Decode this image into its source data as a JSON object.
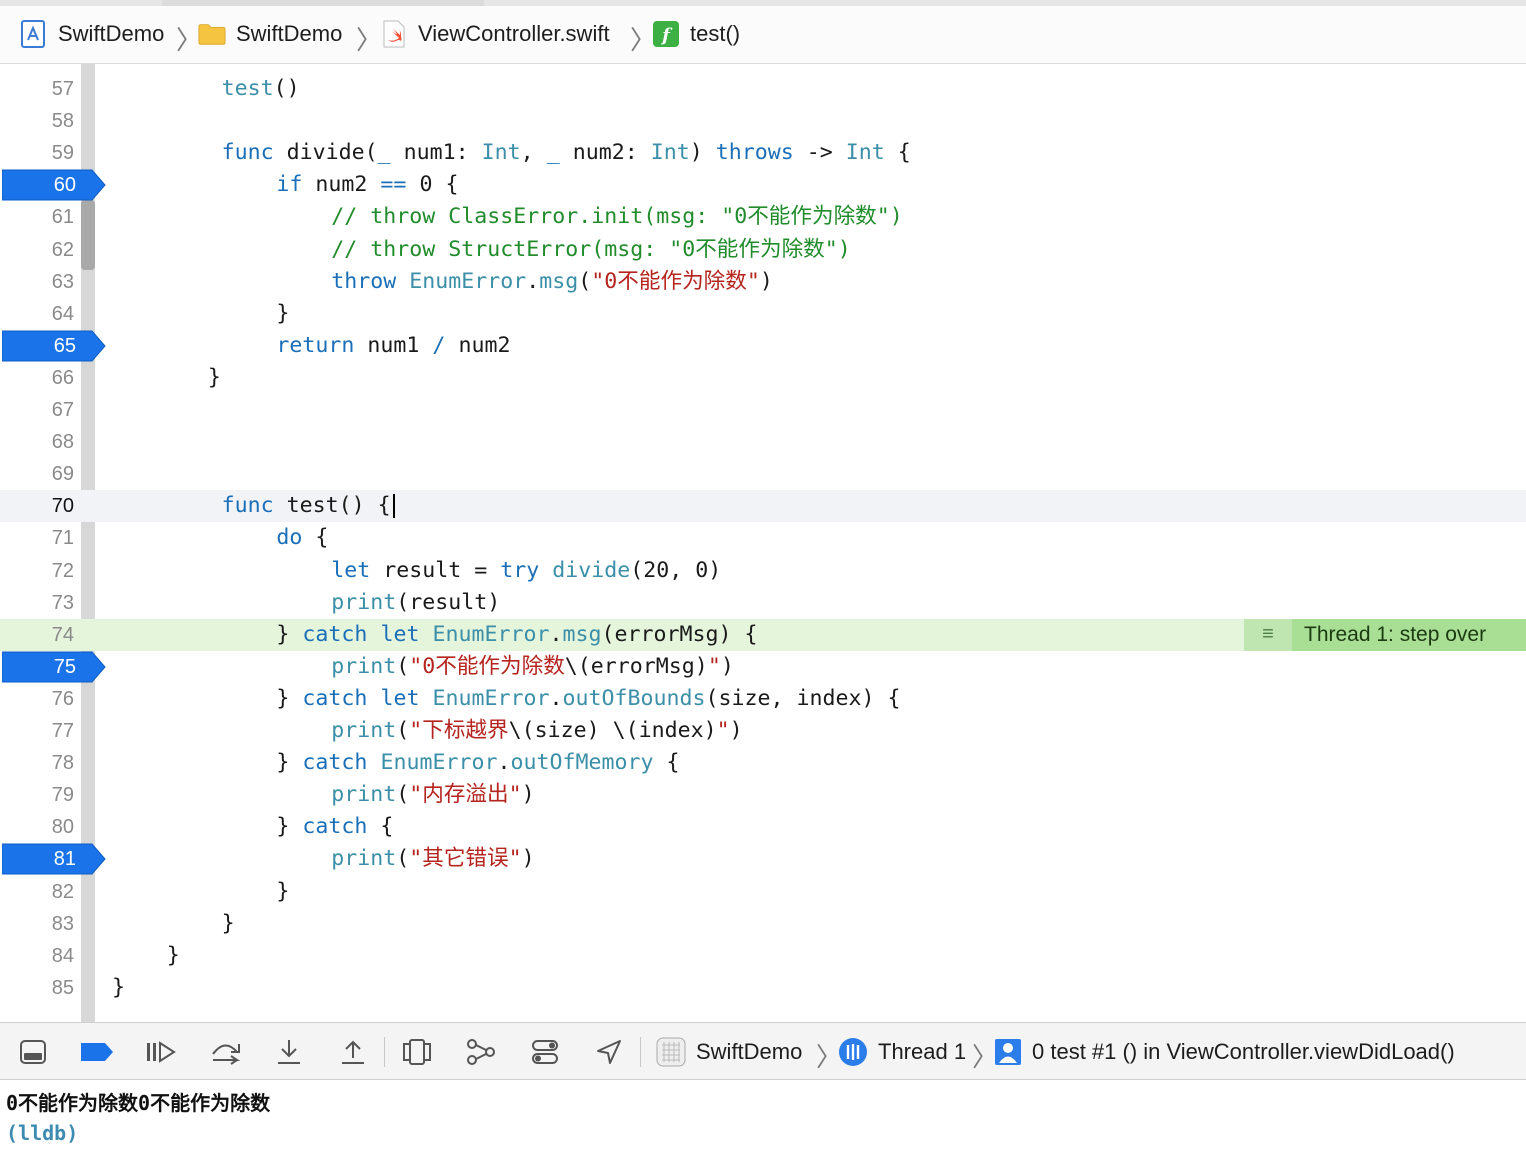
{
  "breadcrumb": {
    "project": "SwiftDemo",
    "group": "SwiftDemo",
    "file": "ViewController.swift",
    "symbol": "test()"
  },
  "editor": {
    "first_line_number": 57,
    "lines": [
      {
        "n": "57",
        "t": [
          [
            "fn",
            "test"
          ],
          [
            "p",
            "()"
          ]
        ],
        "indent": 4
      },
      {
        "n": "58",
        "t": [],
        "indent": 0
      },
      {
        "n": "59",
        "t": [
          [
            "kw",
            "func"
          ],
          [
            "p",
            " divide("
          ],
          [
            "kw",
            "_"
          ],
          [
            "p",
            " num1: "
          ],
          [
            "ty",
            "Int"
          ],
          [
            "p",
            ", "
          ],
          [
            "kw",
            "_"
          ],
          [
            "p",
            " num2: "
          ],
          [
            "ty",
            "Int"
          ],
          [
            "p",
            ") "
          ],
          [
            "kw",
            "throws"
          ],
          [
            "p",
            " -> "
          ],
          [
            "ty",
            "Int"
          ],
          [
            "p",
            " {"
          ]
        ],
        "indent": 4
      },
      {
        "n": "60",
        "t": [
          [
            "kw",
            "if"
          ],
          [
            "p",
            " num2 "
          ],
          [
            "kw",
            "=="
          ],
          [
            "p",
            " 0 {"
          ]
        ],
        "indent": 6
      },
      {
        "n": "61",
        "t": [
          [
            "cm",
            "// throw ClassError.init(msg: \"0不能作为除数\")"
          ]
        ],
        "indent": 8
      },
      {
        "n": "62",
        "t": [
          [
            "cm",
            "// throw StructError(msg: \"0不能作为除数\")"
          ]
        ],
        "indent": 8
      },
      {
        "n": "63",
        "t": [
          [
            "kw",
            "throw"
          ],
          [
            "p",
            " "
          ],
          [
            "ty",
            "EnumError"
          ],
          [
            "p",
            "."
          ],
          [
            "fn",
            "msg"
          ],
          [
            "p",
            "("
          ],
          [
            "st",
            "\"0不能作为除数\""
          ],
          [
            "p",
            ")"
          ]
        ],
        "indent": 8
      },
      {
        "n": "64",
        "t": [
          [
            "p",
            "}"
          ]
        ],
        "indent": 6
      },
      {
        "n": "65",
        "t": [
          [
            "kw",
            "return"
          ],
          [
            "p",
            " num1 "
          ],
          [
            "kw",
            "/"
          ],
          [
            "p",
            " num2"
          ]
        ],
        "indent": 6
      },
      {
        "n": "66",
        "t": [
          [
            "p",
            "}"
          ]
        ],
        "indent": 3.5
      },
      {
        "n": "67",
        "t": [],
        "indent": 0
      },
      {
        "n": "68",
        "t": [],
        "indent": 0
      },
      {
        "n": "69",
        "t": [],
        "indent": 0
      },
      {
        "n": "70",
        "t": [
          [
            "kw",
            "func"
          ],
          [
            "p",
            " test() {"
          ]
        ],
        "indent": 4
      },
      {
        "n": "71",
        "t": [
          [
            "kw",
            "do"
          ],
          [
            "p",
            " {"
          ]
        ],
        "indent": 6
      },
      {
        "n": "72",
        "t": [
          [
            "kw",
            "let"
          ],
          [
            "p",
            " result = "
          ],
          [
            "kw",
            "try"
          ],
          [
            "p",
            " "
          ],
          [
            "fn",
            "divide"
          ],
          [
            "p",
            "(20, 0)"
          ]
        ],
        "indent": 8
      },
      {
        "n": "73",
        "t": [
          [
            "fn",
            "print"
          ],
          [
            "p",
            "(result)"
          ]
        ],
        "indent": 8
      },
      {
        "n": "74",
        "t": [
          [
            "p",
            "} "
          ],
          [
            "kw",
            "catch"
          ],
          [
            "p",
            " "
          ],
          [
            "kw",
            "let"
          ],
          [
            "p",
            " "
          ],
          [
            "ty",
            "EnumError"
          ],
          [
            "p",
            "."
          ],
          [
            "fn",
            "msg"
          ],
          [
            "p",
            "(errorMsg) {"
          ]
        ],
        "indent": 6
      },
      {
        "n": "75",
        "t": [
          [
            "fn",
            "print"
          ],
          [
            "p",
            "("
          ],
          [
            "st",
            "\"0不能作为除数"
          ],
          [
            "p",
            "\\(errorMsg)"
          ],
          [
            "st",
            "\""
          ],
          [
            "p",
            ")"
          ]
        ],
        "indent": 8
      },
      {
        "n": "76",
        "t": [
          [
            "p",
            "} "
          ],
          [
            "kw",
            "catch"
          ],
          [
            "p",
            " "
          ],
          [
            "kw",
            "let"
          ],
          [
            "p",
            " "
          ],
          [
            "ty",
            "EnumError"
          ],
          [
            "p",
            "."
          ],
          [
            "fn",
            "outOfBounds"
          ],
          [
            "p",
            "(size, index) {"
          ]
        ],
        "indent": 6
      },
      {
        "n": "77",
        "t": [
          [
            "fn",
            "print"
          ],
          [
            "p",
            "("
          ],
          [
            "st",
            "\"下标越界"
          ],
          [
            "p",
            "\\(size) \\(index)"
          ],
          [
            "st",
            "\""
          ],
          [
            "p",
            ")"
          ]
        ],
        "indent": 8
      },
      {
        "n": "78",
        "t": [
          [
            "p",
            "} "
          ],
          [
            "kw",
            "catch"
          ],
          [
            "p",
            " "
          ],
          [
            "ty",
            "EnumError"
          ],
          [
            "p",
            "."
          ],
          [
            "fn",
            "outOfMemory"
          ],
          [
            "p",
            " {"
          ]
        ],
        "indent": 6
      },
      {
        "n": "79",
        "t": [
          [
            "fn",
            "print"
          ],
          [
            "p",
            "("
          ],
          [
            "st",
            "\"内存溢出\""
          ],
          [
            "p",
            ")"
          ]
        ],
        "indent": 8
      },
      {
        "n": "80",
        "t": [
          [
            "p",
            "} "
          ],
          [
            "kw",
            "catch"
          ],
          [
            "p",
            " {"
          ]
        ],
        "indent": 6
      },
      {
        "n": "81",
        "t": [
          [
            "fn",
            "print"
          ],
          [
            "p",
            "("
          ],
          [
            "st",
            "\"其它错误\""
          ],
          [
            "p",
            ")"
          ]
        ],
        "indent": 8
      },
      {
        "n": "82",
        "t": [
          [
            "p",
            "}"
          ]
        ],
        "indent": 6
      },
      {
        "n": "83",
        "t": [
          [
            "p",
            "}"
          ]
        ],
        "indent": 4
      },
      {
        "n": "84",
        "t": [
          [
            "p",
            "}"
          ]
        ],
        "indent": 2
      },
      {
        "n": "85",
        "t": [
          [
            "p",
            "}"
          ]
        ],
        "indent": 0
      }
    ],
    "breakpoints": [
      "60",
      "65",
      "75",
      "81"
    ],
    "current_line": "70",
    "stepped_line": "74",
    "thread_badge": "Thread 1: step over"
  },
  "debugbar": {
    "target": "SwiftDemo",
    "thread": "Thread 1",
    "frame": "0 test #1 () in ViewController.viewDidLoad()"
  },
  "console": {
    "output": "0不能作为除数0不能作为除数",
    "prompt": "(lldb)"
  }
}
